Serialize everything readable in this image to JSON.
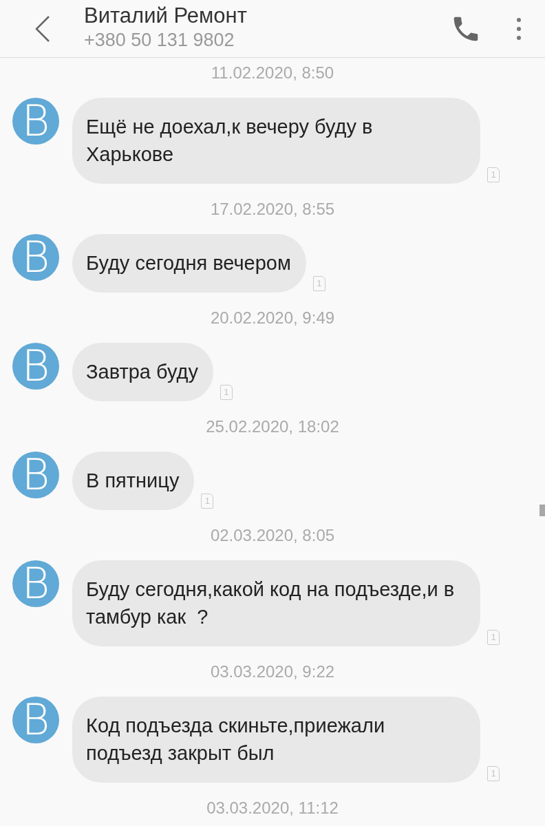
{
  "header": {
    "title": "Виталий Ремонт",
    "subtitle": "+380 50 131 9802"
  },
  "messages": [
    {
      "timestamp": "11.02.2020, 8:50",
      "avatar": "В",
      "text": "Ещё не доехал,к вечеру буду в Харькове",
      "sim": "1"
    },
    {
      "timestamp": "17.02.2020, 8:55",
      "avatar": "В",
      "text": "Буду сегодня вечером",
      "sim": "1"
    },
    {
      "timestamp": "20.02.2020, 9:49",
      "avatar": "В",
      "text": "Завтра буду",
      "sim": "1"
    },
    {
      "timestamp": "25.02.2020, 18:02",
      "avatar": "В",
      "text": "В пятницу",
      "sim": "1"
    },
    {
      "timestamp": "02.03.2020, 8:05",
      "avatar": "В",
      "text": "Буду сегодня,какой код на подъезде,и в тамбур как  ?",
      "sim": "1"
    },
    {
      "timestamp": "03.03.2020, 9:22",
      "avatar": "В",
      "text": "Код подъезда скиньте,приежали подъезд закрыт был",
      "sim": "1"
    }
  ],
  "trailing_timestamp": "03.03.2020, 11:12"
}
